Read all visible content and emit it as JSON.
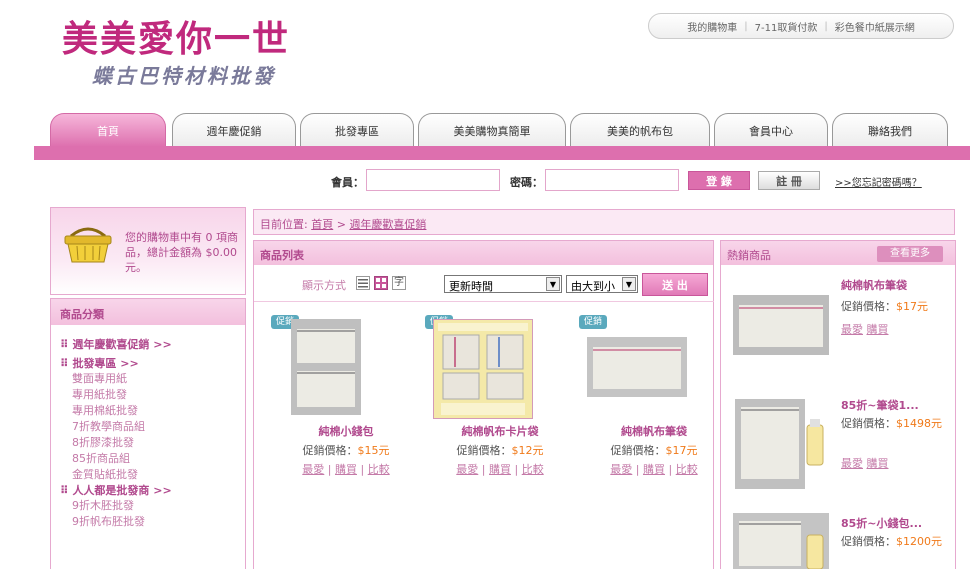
{
  "logo": {
    "main": "美美愛你一世",
    "sub": "蝶古巴特材料批發"
  },
  "toplinks": [
    "我的購物車",
    "7-11取貨付款",
    "彩色餐巾紙展示網"
  ],
  "nav": [
    "首頁",
    "週年慶促銷",
    "批發專區",
    "美美購物真簡單",
    "美美的帆布包",
    "會員中心",
    "聯絡我們"
  ],
  "login": {
    "member_label": "會員：",
    "password_label": "密碼：",
    "login_button": "登 錄",
    "register_button": "註 冊",
    "forgot_link": ">>您忘記密碼嗎？"
  },
  "cart": {
    "text": "您的購物車中有 0 項商品，總計金額為 $0.00元。"
  },
  "categories": {
    "title": "商品分類",
    "groups": [
      {
        "label": "週年慶歡喜促銷 >>",
        "items": []
      },
      {
        "label": "批發專區 >>",
        "items": [
          "雙面專用紙",
          "專用紙批發",
          "專用棉紙批發",
          "7折教學商品組",
          "8折膠漆批發",
          "85折商品組",
          "金質貼紙批發"
        ]
      },
      {
        "label": "人人都是批發商 >>",
        "items": [
          "9折木胚批發",
          "9折帆布胚批發"
        ]
      }
    ]
  },
  "breadcrumb": {
    "prefix": "目前位置:",
    "home": "首頁",
    "sep": ">",
    "current": "週年慶歡喜促銷"
  },
  "product_list": {
    "title": "商品列表",
    "display_label": "顯示方式",
    "sort_field": "更新時間",
    "sort_order": "由大到小",
    "submit_button": "送 出",
    "badge": "促銷",
    "price_label": "促銷價格：",
    "links": [
      "最愛",
      "購買",
      "比較"
    ],
    "items": [
      {
        "name": "純棉小錢包",
        "price": "$15元"
      },
      {
        "name": "純棉帆布卡片袋",
        "price": "$12元"
      },
      {
        "name": "純棉帆布筆袋",
        "price": "$17元"
      }
    ]
  },
  "hot": {
    "title": "熱銷商品",
    "more_button": "查看更多",
    "price_label": "促銷價格：",
    "links": [
      "最愛",
      "購買"
    ],
    "items": [
      {
        "name": "純棉帆布筆袋",
        "price": "$17元"
      },
      {
        "name": "85折~筆袋1...",
        "price": "$1498元"
      },
      {
        "name": "85折~小錢包...",
        "price": "$1200元"
      }
    ]
  },
  "colors": {
    "brand": "#c0297d",
    "accent": "#dd6fae",
    "price": "#f07a1a"
  }
}
